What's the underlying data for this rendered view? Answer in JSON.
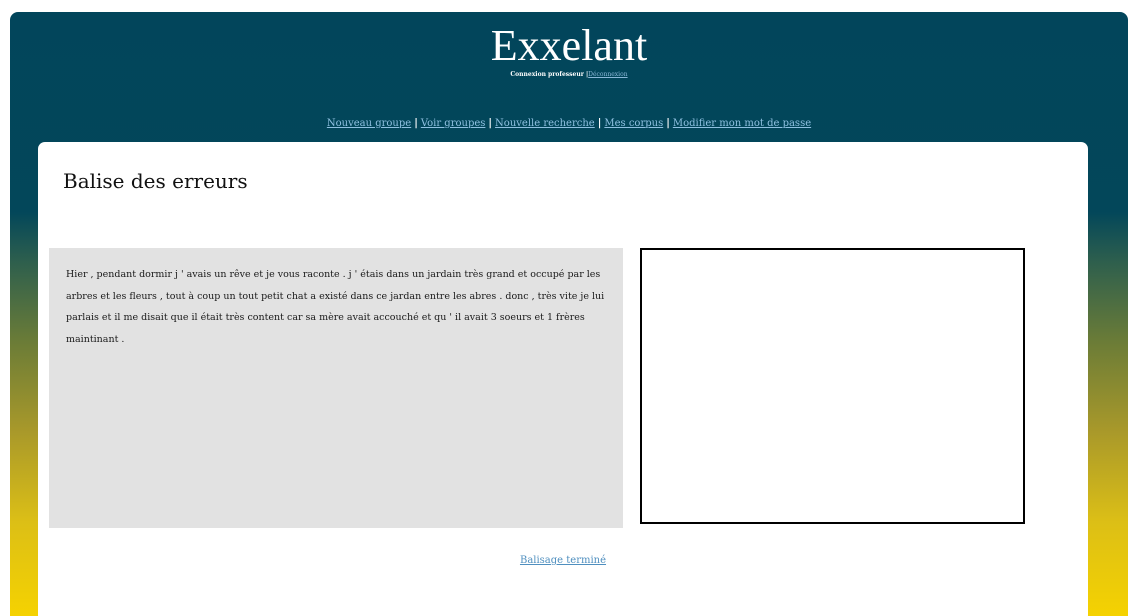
{
  "header": {
    "title": "Exxelant",
    "login_status": "Connexion professeur |",
    "logout_label": "Déconnexion"
  },
  "nav": {
    "items": [
      {
        "label": "Nouveau groupe"
      },
      {
        "label": "Voir groupes"
      },
      {
        "label": "Nouvelle recherche"
      },
      {
        "label": "Mes corpus"
      },
      {
        "label": "Modifier mon mot de passe"
      }
    ],
    "separator": "|"
  },
  "main": {
    "page_title": "Balise des erreurs",
    "text": "Hier , pendant dormir j ' avais un rêve et je vous raconte . j ' étais dans un jardain très grand et occupé par les arbres et les fleurs , tout à coup un tout petit chat a existé dans ce jardan entre les abres . donc , très vite je lui parlais et il me disait que il était très content car sa mère avait accouché et qu ' il avait 3 soeurs et 1 frères maintinant .",
    "finish_label": "Balisage terminé"
  },
  "colors": {
    "header_top": "#02455b",
    "footer_bottom": "#f5d201",
    "text_panel_bg": "#e2e2e2",
    "link": "#8ec0e0"
  }
}
